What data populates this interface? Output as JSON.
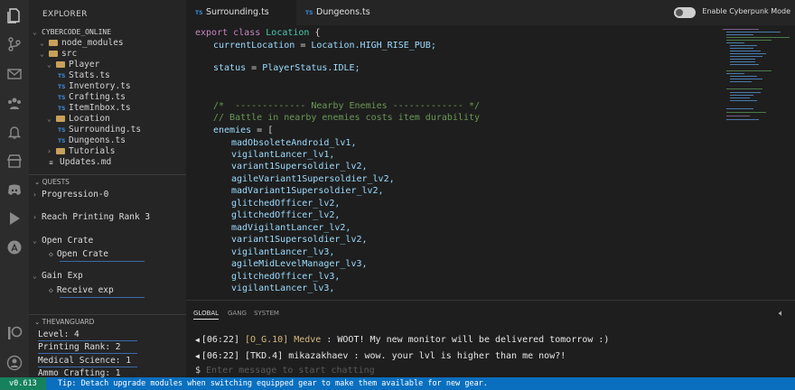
{
  "explorer": {
    "title": "EXPLORER",
    "tree": [
      {
        "label": "CYBERCODE_ONLINE",
        "kind": "root"
      },
      {
        "label": "node_modules",
        "kind": "folder"
      },
      {
        "label": "src",
        "kind": "folder"
      },
      {
        "label": "Player",
        "kind": "folder"
      },
      {
        "label": "Stats.ts",
        "kind": "file"
      },
      {
        "label": "Inventory.ts",
        "kind": "file"
      },
      {
        "label": "Crafting.ts",
        "kind": "file"
      },
      {
        "label": "ItemInbox.ts",
        "kind": "file"
      },
      {
        "label": "Location",
        "kind": "folder"
      },
      {
        "label": "Surrounding.ts",
        "kind": "file"
      },
      {
        "label": "Dungeons.ts",
        "kind": "file"
      },
      {
        "label": "Tutorials",
        "kind": "folder"
      },
      {
        "label": "Updates.md",
        "kind": "file"
      }
    ]
  },
  "quests": {
    "title": "QUESTS",
    "items": [
      {
        "label": "Progression-0"
      },
      {
        "label": "Reach Printing Rank 3"
      },
      {
        "label": "Open Crate",
        "sub": "Open Crate"
      },
      {
        "label": "Gain Exp",
        "sub": "Receive exp"
      }
    ]
  },
  "faction": {
    "title": "THEVANGUARD",
    "stats": [
      "Level: 4",
      "Printing Rank: 2",
      "Medical Science: 1",
      "Ammo Crafting: 1"
    ]
  },
  "tabs": [
    {
      "icon": "TS",
      "label": "Surrounding.ts"
    },
    {
      "icon": "TS",
      "label": "Dungeons.ts"
    }
  ],
  "cyberpunk_toggle": {
    "label": "Enable Cyberpunk Mode",
    "on": false
  },
  "code": {
    "l1": {
      "kw": "export class ",
      "cls": "Location",
      "rest": " {"
    },
    "l2": {
      "a": "currentLocation",
      "b": " = ",
      "c": "Location.HIGH_RISE_PUB;"
    },
    "l3": {
      "a": "status",
      "b": " = ",
      "c": "PlayerStatus.IDLE;"
    },
    "l4": "/*  ------------- Nearby Enemies ------------- */",
    "l5": "// Battle in nearby enemies costs item durability",
    "l6": {
      "a": "enemies",
      "b": " = ["
    },
    "enemies": [
      "madObsoleteAndroid_lv1,",
      "vigilantLancer_lv1,",
      "variant1Supersoldier_lv2,",
      "agileVariant1Supersoldier_lv2,",
      "madVariant1Supersoldier_lv2,",
      "glitchedOfficer_lv2,",
      "glitchedOfficer_lv2,",
      "madVigilantLancer_lv2,",
      "variant1Supersoldier_lv2,",
      "vigilantLancer_lv3,",
      "agileMidLevelManager_lv3,",
      "glitchedOfficer_lv3,",
      "vigilantLancer_lv3,"
    ]
  },
  "chat": {
    "tabs": [
      "GLOBAL",
      "GANG",
      "SYSTEM"
    ],
    "messages": [
      {
        "time": "[06:22]",
        "tag": "[O_G.10]",
        "user": "Medve",
        "text": " : WOOT! My new monitor will be delivered tomorrow :)"
      },
      {
        "time": "[06:22]",
        "tag": "[TKD.4]",
        "user": "mikazakhaev",
        "text": " : wow. your lvl is higher than me now?!"
      }
    ],
    "prompt": "$",
    "input_placeholder": "Enter message to start chatting"
  },
  "status_bar": {
    "version": "v0.613",
    "tip": "Tip: Detach upgrade modules when switching equipped gear to make them available for new gear."
  },
  "colors": {
    "accent": "#0a6fbf",
    "version_bg": "#16825d",
    "quest_bar": "#3d6aa8"
  }
}
